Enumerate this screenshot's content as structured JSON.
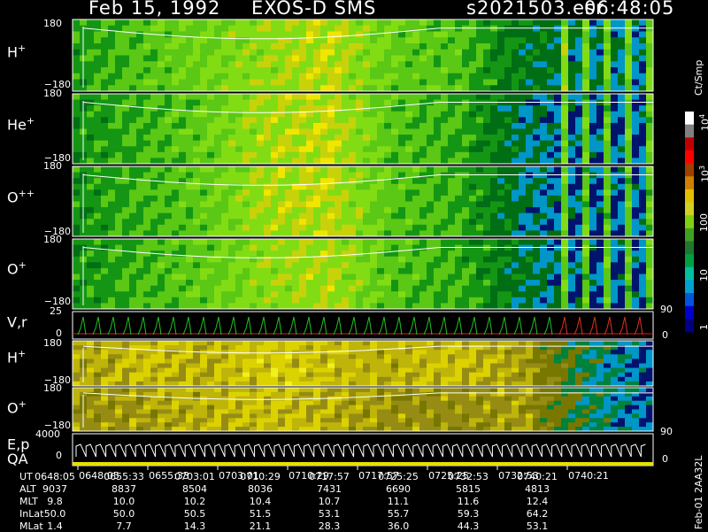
{
  "header": {
    "date": "Feb 15, 1992",
    "instrument": "EXOS-D SMS",
    "file": "s2021503.esr",
    "time": "06:48:05"
  },
  "panels": [
    {
      "label": "H",
      "charge": "+",
      "ymax": "180",
      "ymin": "−180"
    },
    {
      "label": "He",
      "charge": "+",
      "ymax": "180",
      "ymin": "−180"
    },
    {
      "label": "O",
      "charge": "++",
      "ymax": "180",
      "ymin": "−180"
    },
    {
      "label": "O",
      "charge": "+",
      "ymax": "180",
      "ymin": "−180"
    },
    {
      "label": "V,r",
      "charge": "",
      "ymax": "25",
      "ymin": "0"
    },
    {
      "label": "H",
      "charge": "+",
      "ymax": "180",
      "ymin": "−180"
    },
    {
      "label": "O",
      "charge": "+",
      "ymax": "180",
      "ymin": "−180"
    },
    {
      "label": "E,p",
      "charge": "",
      "ymax": "4000",
      "ymin": "0"
    }
  ],
  "qa_label": "QA",
  "right_ticks": {
    "vr_top": "90",
    "vr_bottom": "0",
    "o_bottom": "90",
    "ep_bottom": "0"
  },
  "colorbar": {
    "unit": "Ct/Smp",
    "labels": [
      "1",
      "10",
      "100",
      "10",
      "10"
    ],
    "exponents": [
      "",
      "",
      "",
      "3",
      "4"
    ],
    "colors": [
      "#000080",
      "#0000cc",
      "#0055dd",
      "#00a0d0",
      "#00c0a0",
      "#00a040",
      "#207830",
      "#40a020",
      "#80d010",
      "#d0d020",
      "#e0c000",
      "#d08000",
      "#a04000",
      "#ff0000",
      "#c00000",
      "#808080",
      "#ffffff"
    ]
  },
  "side_label": "Feb-01 2AA32L",
  "table": {
    "rows": [
      {
        "name": "UT",
        "values": [
          "0648:05",
          "0655:33",
          "0703:01",
          "0710:29",
          "0717:57",
          "0725:25",
          "0732:53",
          "0740:21"
        ]
      },
      {
        "name": "ALT",
        "values": [
          "9037",
          "8837",
          "8504",
          "8036",
          "7431",
          "6690",
          "5815",
          "4813"
        ]
      },
      {
        "name": "MLT",
        "values": [
          "9.8",
          "10.0",
          "10.2",
          "10.4",
          "10.7",
          "11.1",
          "11.6",
          "12.4"
        ]
      },
      {
        "name": "InLat",
        "values": [
          "50.0",
          "50.0",
          "50.5",
          "51.5",
          "53.1",
          "55.7",
          "59.3",
          "64.2"
        ]
      },
      {
        "name": "MLat",
        "values": [
          "1.4",
          "7.7",
          "14.3",
          "21.1",
          "28.3",
          "36.0",
          "44.3",
          "53.1"
        ]
      }
    ]
  },
  "chart_data": {
    "type": "heatmap",
    "x": [
      "0648:05",
      "0655:33",
      "0703:01",
      "0710:29",
      "0717:57",
      "0725:25",
      "0732:53",
      "0740:21"
    ],
    "color_scale": "log",
    "color_range": [
      1,
      10000
    ],
    "series": [
      {
        "name": "H+",
        "ylim": [
          -180,
          180
        ],
        "profile": [
          0.45,
          0.55,
          0.65,
          0.75,
          0.85,
          0.6,
          0.55,
          0.3,
          0.2,
          0.15
        ]
      },
      {
        "name": "He+",
        "ylim": [
          -180,
          180
        ],
        "profile": [
          0.4,
          0.5,
          0.6,
          0.8,
          0.85,
          0.55,
          0.5,
          0.2,
          0.1,
          0.1
        ]
      },
      {
        "name": "O++",
        "ylim": [
          -180,
          180
        ],
        "profile": [
          0.4,
          0.5,
          0.6,
          0.8,
          0.85,
          0.55,
          0.5,
          0.2,
          0.1,
          0.1
        ]
      },
      {
        "name": "O+",
        "ylim": [
          -180,
          180
        ],
        "profile": [
          0.4,
          0.5,
          0.6,
          0.75,
          0.8,
          0.55,
          0.5,
          0.25,
          0.1,
          0.1
        ]
      },
      {
        "name": "V,r",
        "ylim": [
          0,
          25
        ]
      },
      {
        "name": "H+",
        "ylim": [
          -180,
          180
        ],
        "profile": [
          0.5,
          0.6,
          0.55,
          0.65,
          0.6,
          0.55,
          0.6,
          0.5,
          0.25,
          0.1
        ]
      },
      {
        "name": "O+",
        "ylim": [
          -180,
          180
        ],
        "profile": [
          0.45,
          0.5,
          0.55,
          0.6,
          0.55,
          0.45,
          0.45,
          0.5,
          0.25,
          0.1
        ]
      },
      {
        "name": "E,p",
        "ylim": [
          0,
          4000
        ]
      }
    ]
  }
}
